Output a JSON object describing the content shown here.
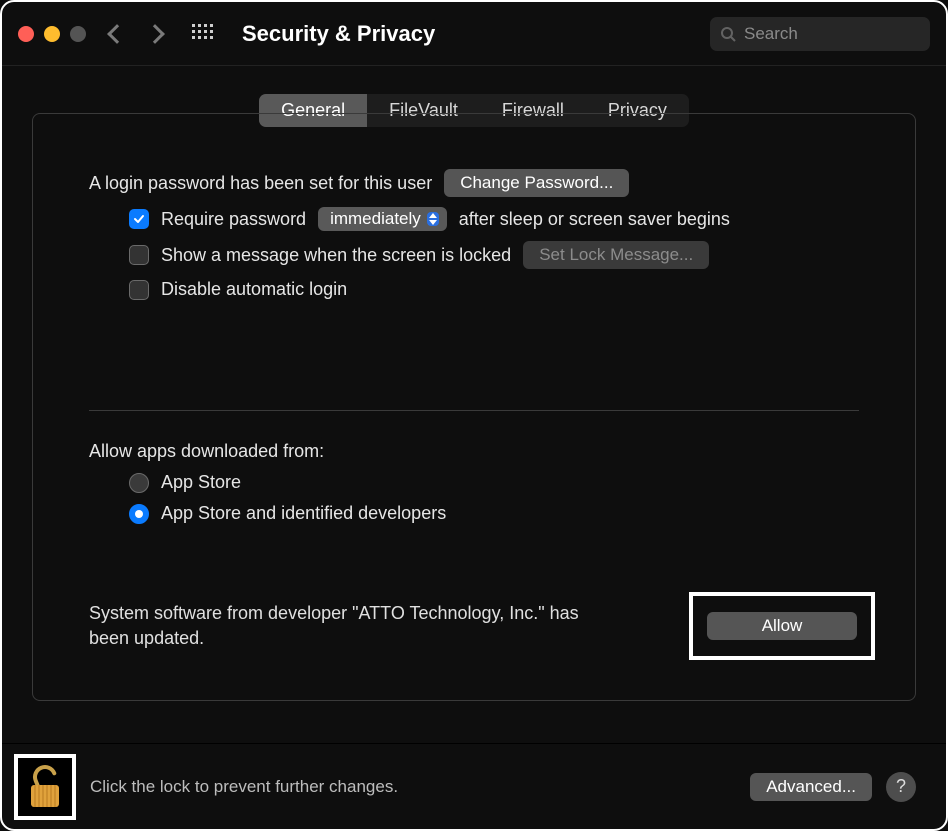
{
  "titlebar": {
    "title": "Security & Privacy",
    "search_placeholder": "Search"
  },
  "tabs": {
    "general": "General",
    "filevault": "FileVault",
    "firewall": "Firewall",
    "privacy": "Privacy"
  },
  "general": {
    "login_msg": "A login password has been set for this user",
    "change_password": "Change Password...",
    "require_password_pre": "Require password",
    "require_password_value": "immediately",
    "require_password_post": "after sleep or screen saver begins",
    "show_message": "Show a message when the screen is locked",
    "set_lock_message": "Set Lock Message...",
    "disable_auto_login": "Disable automatic login",
    "allow_apps_label": "Allow apps downloaded from:",
    "app_store": "App Store",
    "app_store_dev": "App Store and identified developers",
    "system_software_msg": "System software from developer \"ATTO Technology, Inc.\" has been updated.",
    "allow": "Allow"
  },
  "footer": {
    "lock_msg": "Click the lock to prevent further changes.",
    "advanced": "Advanced...",
    "help": "?"
  }
}
